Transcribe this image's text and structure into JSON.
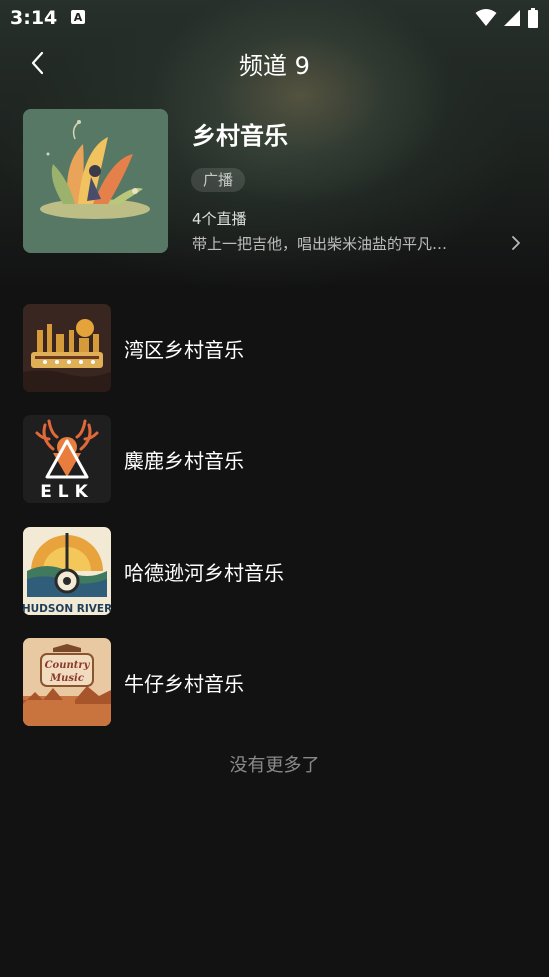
{
  "status_bar": {
    "time": "3:14",
    "notification_icon": "a-icon",
    "icons": [
      "wifi-icon",
      "signal-icon",
      "battery-icon"
    ]
  },
  "header": {
    "title": "频道 9",
    "back_icon": "back-chevron-icon"
  },
  "channel": {
    "name": "乡村音乐",
    "tag": "广播",
    "live_count": "4个直播",
    "description": "带上一把吉他，唱出柴米油盐的平凡…",
    "cover_icon": "country-illustration"
  },
  "stations": [
    {
      "name": "湾区乡村音乐",
      "cover": "bay-area-cover"
    },
    {
      "name": "麋鹿乡村音乐",
      "cover": "elk-cover",
      "cover_text": "ELK"
    },
    {
      "name": "哈德逊河乡村音乐",
      "cover": "hudson-river-cover",
      "cover_text": "HUDSON RIVER"
    },
    {
      "name": "牛仔乡村音乐",
      "cover": "country-music-cover",
      "cover_text": "Country Music"
    }
  ],
  "footer": {
    "no_more": "没有更多了"
  },
  "colors": {
    "background": "#121212",
    "text_primary": "#ffffff",
    "text_secondary": "#a8a8a8"
  }
}
